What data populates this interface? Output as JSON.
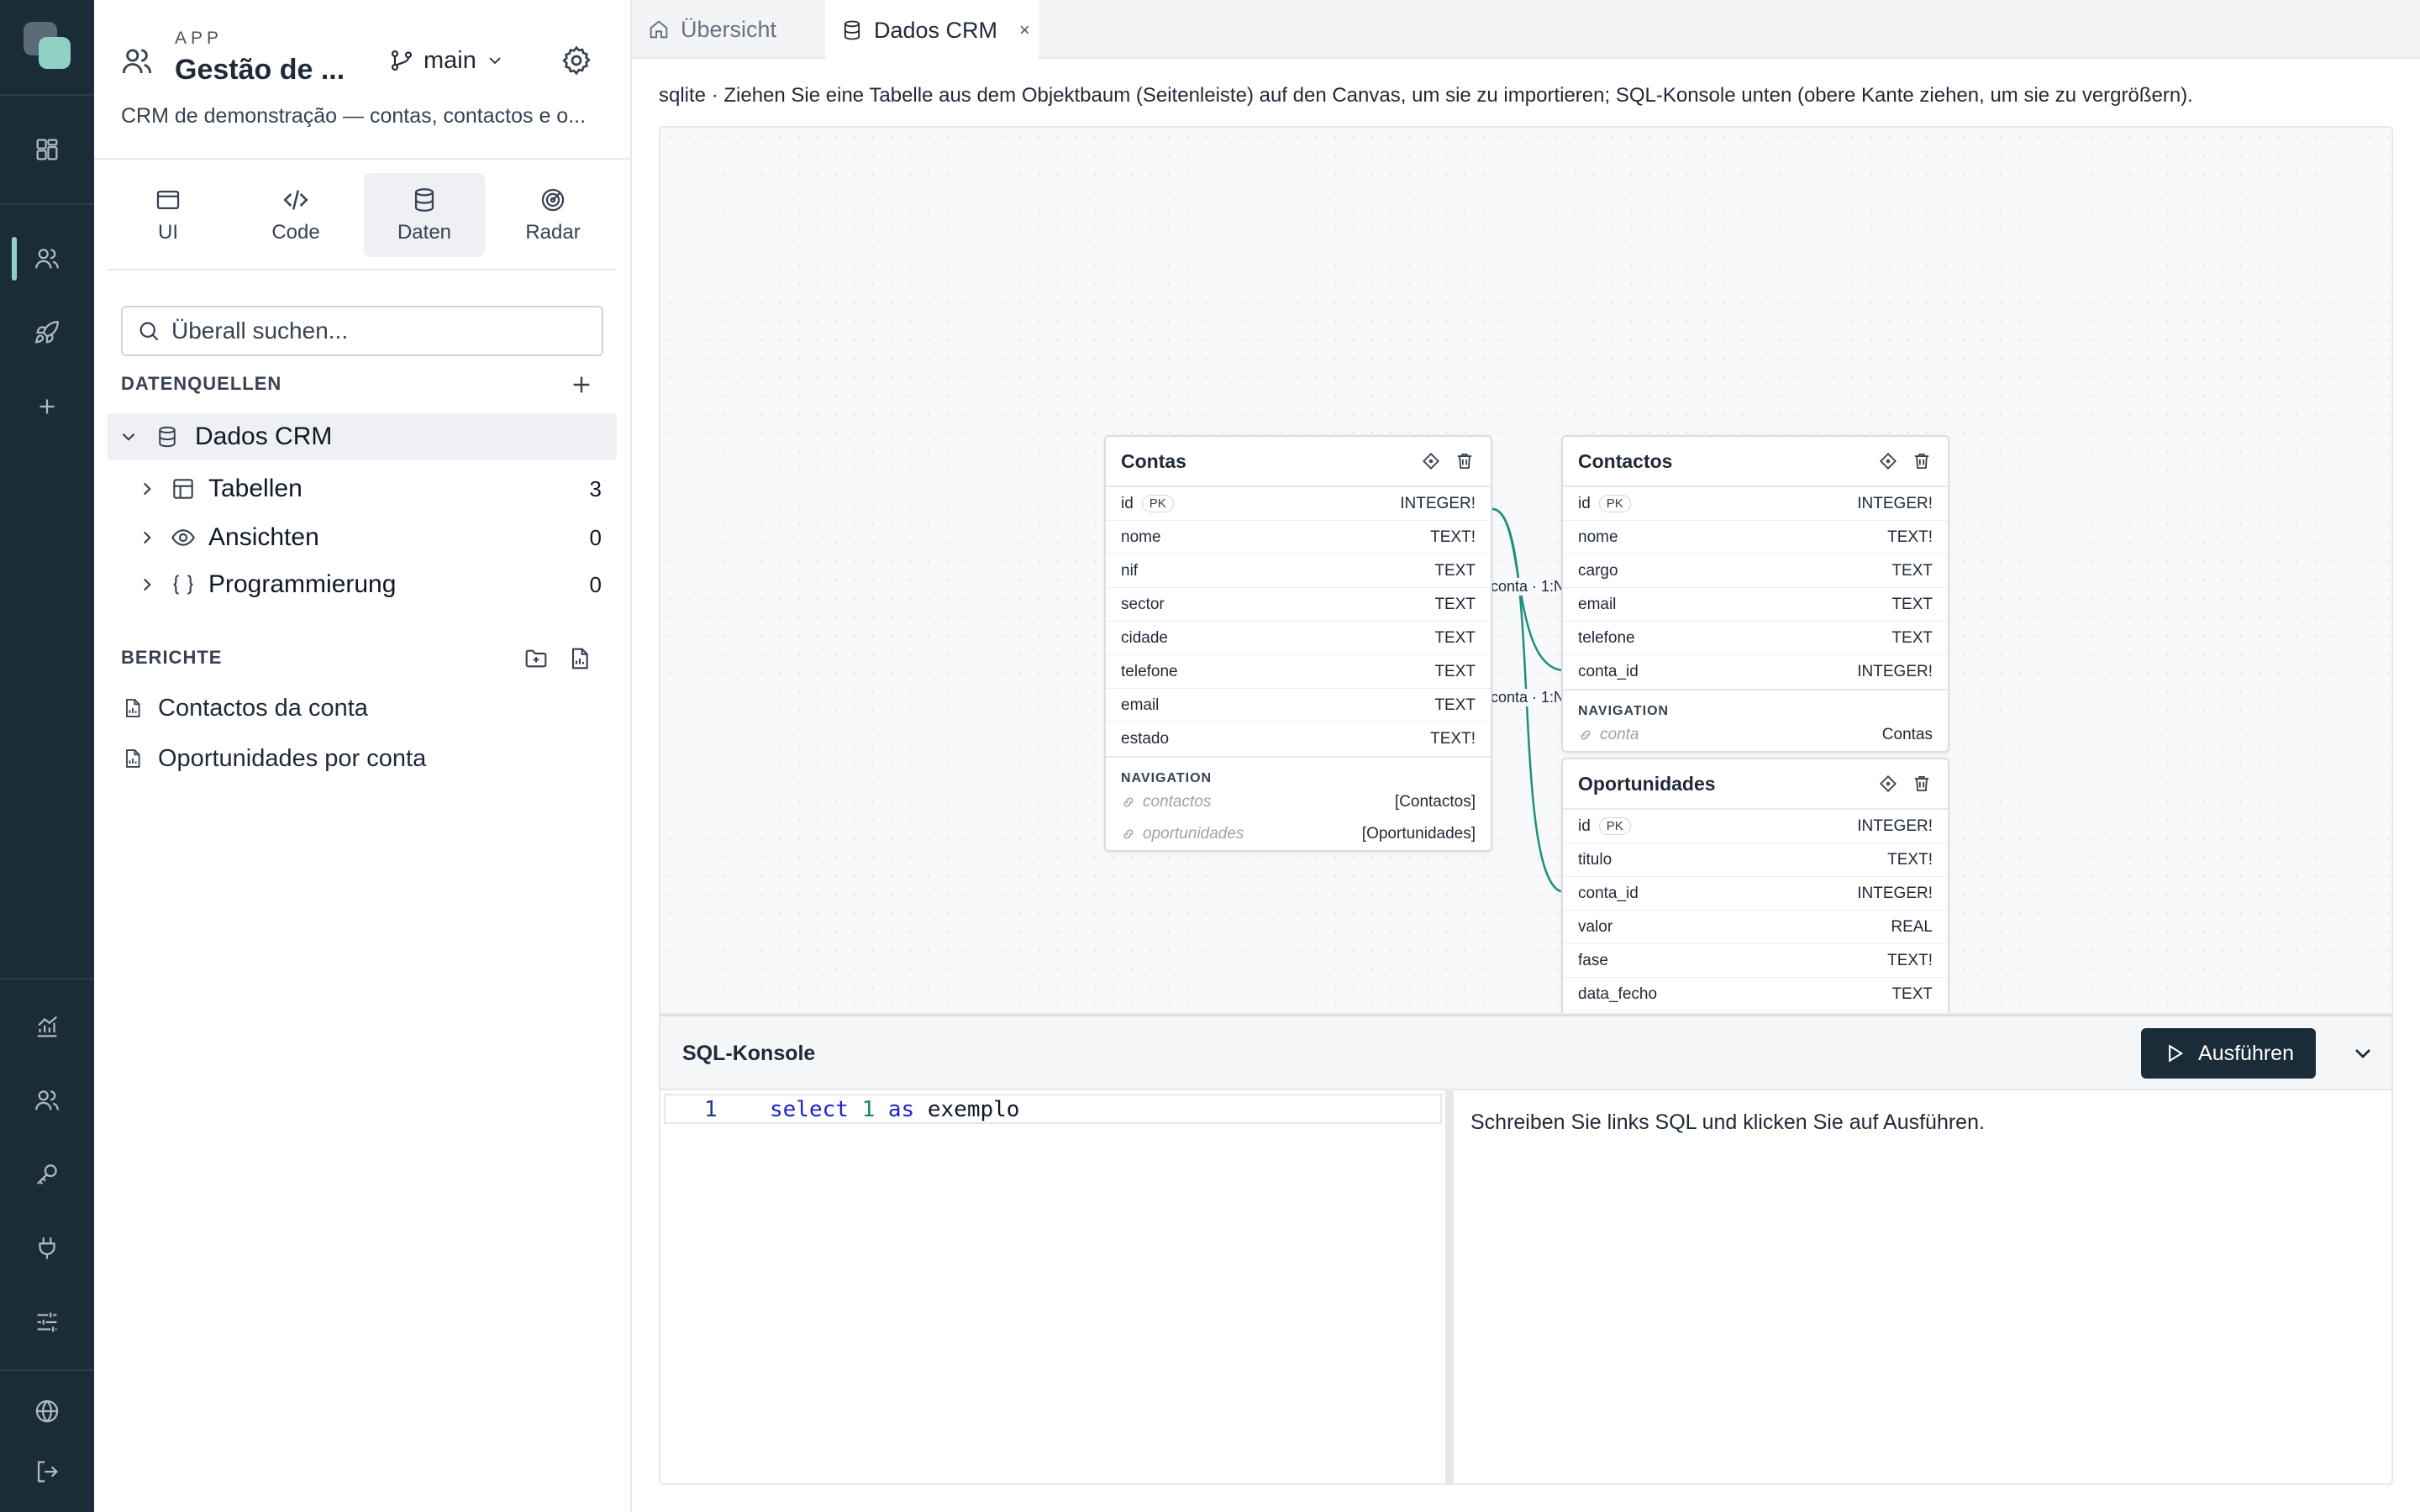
{
  "app": {
    "eyebrow": "APP",
    "title": "Gestão de ...",
    "branch": "main",
    "description": "CRM de demonstração — contas, contactos e o..."
  },
  "mode_tabs": [
    {
      "label": "UI",
      "icon": "window-icon"
    },
    {
      "label": "Code",
      "icon": "code-icon"
    },
    {
      "label": "Daten",
      "icon": "database-icon",
      "active": true
    },
    {
      "label": "Radar",
      "icon": "radar-icon"
    }
  ],
  "search": {
    "placeholder": "Überall suchen..."
  },
  "datasources": {
    "heading": "DATENQUELLEN",
    "root": "Dados CRM",
    "items": [
      {
        "label": "Tabellen",
        "count": "3",
        "icon": "table-icon"
      },
      {
        "label": "Ansichten",
        "count": "0",
        "icon": "eye-icon"
      },
      {
        "label": "Programmierung",
        "count": "0",
        "icon": "braces-icon"
      }
    ]
  },
  "reports": {
    "heading": "BERICHTE",
    "items": [
      {
        "label": "Contactos da conta"
      },
      {
        "label": "Oportunidades por conta"
      }
    ]
  },
  "tabs": [
    {
      "label": "Übersicht",
      "icon": "home-icon",
      "active": false
    },
    {
      "label": "Dados CRM",
      "icon": "database-icon",
      "active": true,
      "close": "×"
    }
  ],
  "hint": "sqlite · Ziehen Sie eine Tabelle aus dem Objektbaum (Seitenleiste) auf den Canvas, um sie zu importieren; SQL-Konsole unten (obere Kante ziehen, um sie zu vergrößern).",
  "pk_label": "PK",
  "nav_heading": "NAVIGATION",
  "entities": {
    "contas": {
      "title": "Contas",
      "columns": [
        {
          "name": "id",
          "type": "INTEGER!",
          "pk": true
        },
        {
          "name": "nome",
          "type": "TEXT!"
        },
        {
          "name": "nif",
          "type": "TEXT"
        },
        {
          "name": "sector",
          "type": "TEXT"
        },
        {
          "name": "cidade",
          "type": "TEXT"
        },
        {
          "name": "telefone",
          "type": "TEXT"
        },
        {
          "name": "email",
          "type": "TEXT"
        },
        {
          "name": "estado",
          "type": "TEXT!"
        }
      ],
      "navigation": [
        {
          "name": "contactos",
          "type": "[Contactos]"
        },
        {
          "name": "oportunidades",
          "type": "[Oportunidades]"
        }
      ]
    },
    "contactos": {
      "title": "Contactos",
      "columns": [
        {
          "name": "id",
          "type": "INTEGER!",
          "pk": true
        },
        {
          "name": "nome",
          "type": "TEXT!"
        },
        {
          "name": "cargo",
          "type": "TEXT"
        },
        {
          "name": "email",
          "type": "TEXT"
        },
        {
          "name": "telefone",
          "type": "TEXT"
        },
        {
          "name": "conta_id",
          "type": "INTEGER!"
        }
      ],
      "navigation": [
        {
          "name": "conta",
          "type": "Contas"
        }
      ]
    },
    "oportunidades": {
      "title": "Oportunidades",
      "columns": [
        {
          "name": "id",
          "type": "INTEGER!",
          "pk": true
        },
        {
          "name": "titulo",
          "type": "TEXT!"
        },
        {
          "name": "conta_id",
          "type": "INTEGER!"
        },
        {
          "name": "valor",
          "type": "REAL"
        },
        {
          "name": "fase",
          "type": "TEXT!"
        },
        {
          "name": "data_fecho",
          "type": "TEXT"
        }
      ]
    }
  },
  "relations": [
    {
      "label": "conta · 1:N"
    },
    {
      "label": "conta · 1:N"
    }
  ],
  "colors": {
    "rail": "#1a2c38",
    "accent": "#8fd1c4",
    "relation": "#1f8f7a"
  },
  "console": {
    "title": "SQL-Konsole",
    "run_label": "Ausführen",
    "line_number": "1",
    "code": {
      "kw1": "select",
      "num": "1",
      "kw2": "as",
      "ident": "exemplo"
    },
    "result_hint": "Schreiben Sie links SQL und klicken Sie auf Ausführen."
  }
}
